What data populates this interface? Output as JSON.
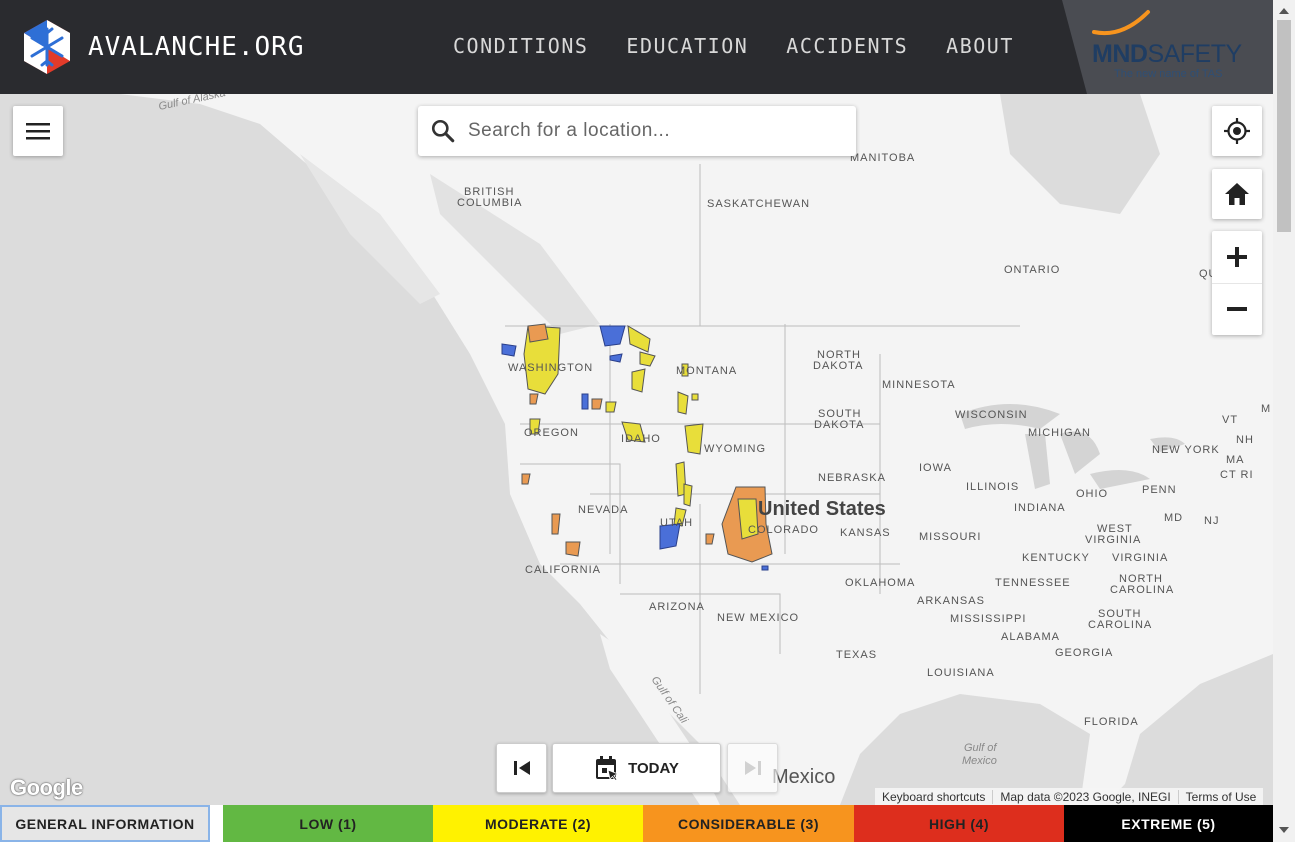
{
  "header": {
    "site_name": "AVALANCHE.ORG",
    "nav": [
      "CONDITIONS",
      "EDUCATION",
      "ACCIDENTS",
      "ABOUT"
    ],
    "sponsor": {
      "name_bold": "MND",
      "name_light": "SAFETY",
      "tagline": "The new name of TAS"
    }
  },
  "search": {
    "placeholder": "Search for a location..."
  },
  "map": {
    "labels": {
      "british_columbia_1": "BRITISH",
      "british_columbia_2": "COLUMBIA",
      "saskatchewan": "SASKATCHEWAN",
      "manitoba": "MANITOBA",
      "ontario": "ONTARIO",
      "quebec": "QU",
      "washington": "WASHINGTON",
      "montana": "MONTANA",
      "north_dakota_1": "NORTH",
      "north_dakota_2": "DAKOTA",
      "minnesota": "MINNESOTA",
      "oregon": "OREGON",
      "idaho": "IDAHO",
      "wyoming": "WYOMING",
      "south_dakota_1": "SOUTH",
      "south_dakota_2": "DAKOTA",
      "wisconsin": "WISCONSIN",
      "michigan": "MICHIGAN",
      "iowa": "IOWA",
      "nebraska": "NEBRASKA",
      "nevada": "NEVADA",
      "utah": "UTAH",
      "colorado": "COLORADO",
      "united_states": "United States",
      "kansas": "KANSAS",
      "illinois": "ILLINOIS",
      "indiana": "INDIANA",
      "ohio": "OHIO",
      "penn": "PENN",
      "new_york": "NEW YORK",
      "vt": "VT",
      "nh": "NH",
      "ma": "MA",
      "ct_ri": "CT RI",
      "nj": "NJ",
      "md": "MD",
      "me": "M",
      "missouri": "MISSOURI",
      "west_virginia_1": "WEST",
      "west_virginia_2": "VIRGINIA",
      "virginia": "VIRGINIA",
      "kentucky": "KENTUCKY",
      "california": "CALIFORNIA",
      "arizona": "ARIZONA",
      "new_mexico": "NEW MEXICO",
      "oklahoma": "OKLAHOMA",
      "tennessee": "TENNESSEE",
      "north_carolina_1": "NORTH",
      "north_carolina_2": "CAROLINA",
      "arkansas": "ARKANSAS",
      "south_carolina_1": "SOUTH",
      "south_carolina_2": "CAROLINA",
      "mississippi": "MISSISSIPPI",
      "alabama": "ALABAMA",
      "georgia": "GEORGIA",
      "texas": "TEXAS",
      "louisiana": "LOUISIANA",
      "florida": "FLORIDA",
      "mexico": "Mexico",
      "gulf_alaska": "Gulf of Alaska",
      "gulf_california": "Gulf of Cali",
      "gulf_mexico_1": "Gulf of",
      "gulf_mexico_2": "Mexico"
    },
    "google": "Google",
    "attribution": [
      "Keyboard shortcuts",
      "Map data ©2023 Google, INEGI",
      "Terms of Use"
    ]
  },
  "date_nav": {
    "today": "TODAY"
  },
  "legend": {
    "general": "GENERAL INFORMATION",
    "levels": [
      {
        "label": "LOW (1)",
        "color": "#62b843",
        "text": "#222222"
      },
      {
        "label": "MODERATE (2)",
        "color": "#fff200",
        "text": "#222222"
      },
      {
        "label": "CONSIDERABLE (3)",
        "color": "#f7941e",
        "text": "#222222"
      },
      {
        "label": "HIGH (4)",
        "color": "#dd2e1d",
        "text": "#222222"
      },
      {
        "label": "EXTREME (5)",
        "color": "#000000",
        "text": "#ffffff"
      }
    ]
  },
  "colors": {
    "header_bg": "#2a2b2f",
    "zone_low": "#4a6fd8",
    "zone_moderate": "#e8de3a",
    "zone_considerable": "#e99a52"
  }
}
